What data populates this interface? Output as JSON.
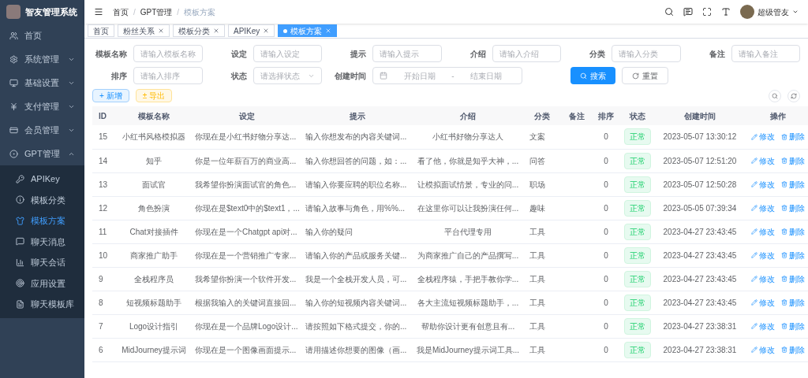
{
  "sidebar": {
    "title": "智友管理系统",
    "items": [
      {
        "label": "首页",
        "selected": false
      },
      {
        "label": "系统管理",
        "expanded": false,
        "selected": false
      },
      {
        "label": "基础设置",
        "expanded": false,
        "selected": false
      },
      {
        "label": "支付管理",
        "expanded": false,
        "selected": false
      },
      {
        "label": "会员管理",
        "expanded": false,
        "selected": false
      },
      {
        "label": "GPT管理",
        "expanded": true,
        "selected": false,
        "children": [
          {
            "label": "APIKey",
            "selected": false
          },
          {
            "label": "模板分类",
            "selected": false
          },
          {
            "label": "模板方案",
            "selected": true
          },
          {
            "label": "聊天消息",
            "selected": false
          },
          {
            "label": "聊天会话",
            "selected": false
          },
          {
            "label": "应用设置",
            "selected": false
          },
          {
            "label": "聊天模板库",
            "selected": false
          }
        ]
      }
    ]
  },
  "header": {
    "breadcrumbs": [
      "首页",
      "GPT管理",
      "模板方案"
    ],
    "separator": "/",
    "user": "超级管友"
  },
  "tags": [
    {
      "label": "首页",
      "closable": false,
      "selected": false
    },
    {
      "label": "粉丝关系",
      "closable": true,
      "selected": false
    },
    {
      "label": "模板分类",
      "closable": true,
      "selected": false
    },
    {
      "label": "APIKey",
      "closable": true,
      "selected": false
    },
    {
      "label": "模板方案",
      "closable": true,
      "selected": true
    }
  ],
  "filters": [
    {
      "kind": "text",
      "label": "模板名称",
      "placeholder": "请输入模板名称"
    },
    {
      "kind": "text",
      "label": "设定",
      "placeholder": "请输入设定"
    },
    {
      "kind": "text",
      "label": "提示",
      "placeholder": "请输入提示"
    },
    {
      "kind": "text",
      "label": "介绍",
      "placeholder": "请输入介绍"
    },
    {
      "kind": "text",
      "label": "分类",
      "placeholder": "请输入分类"
    },
    {
      "kind": "text",
      "label": "备注",
      "placeholder": "请输入备注"
    },
    {
      "kind": "text",
      "label": "排序",
      "placeholder": "请输入排序"
    },
    {
      "kind": "select",
      "label": "状态",
      "placeholder": "请选择状态"
    },
    {
      "kind": "daterange",
      "label": "创建时间",
      "placeholder": "开始日期",
      "placeholder_end": "结束日期",
      "separator": "-"
    }
  ],
  "filter_buttons": [
    {
      "kind": "primary",
      "label": "搜索"
    },
    {
      "kind": "plain",
      "label": "重置"
    }
  ],
  "toolbar": [
    {
      "kind": "add",
      "label": "+ 新增"
    },
    {
      "kind": "export",
      "label": "± 导出"
    }
  ],
  "table": {
    "columns": [
      "ID",
      "模板名称",
      "设定",
      "提示",
      "介绍",
      "分类",
      "备注",
      "排序",
      "状态",
      "创建时间",
      "操作"
    ],
    "rows": [
      {
        "id": "15",
        "name": "小红书风格模拟器",
        "setting": "你现在是小红书好物分享达...",
        "prompt": "输入你想发布的内容关键词...",
        "intro": "小红书好物分享达人",
        "category": "文案",
        "sort": "0",
        "status": "正常",
        "created": "2023-05-07 13:30:12",
        "actions": [
          "修改",
          "删除"
        ]
      },
      {
        "id": "14",
        "name": "知乎",
        "setting": "你是一位年薪百万的商业高...",
        "prompt": "输入你想回答的问题，如：...",
        "intro": "看了他，你就是知乎大神，...",
        "category": "问答",
        "sort": "0",
        "status": "正常",
        "created": "2023-05-07 12:51:20",
        "actions": [
          "修改",
          "删除"
        ]
      },
      {
        "id": "13",
        "name": "面试官",
        "setting": "我希望你扮演面试官的角色...",
        "prompt": "请输入你要应聘的职位名称...",
        "intro": "让模拟面试情景，专业的问...",
        "category": "职场",
        "sort": "0",
        "status": "正常",
        "created": "2023-05-07 12:50:28",
        "actions": [
          "修改",
          "删除"
        ]
      },
      {
        "id": "12",
        "name": "角色扮演",
        "setting": "你现在是$text0中的$text1，...",
        "prompt": "请输入故事与角色，用%%...",
        "intro": "在这里你可以让我扮演任何...",
        "category": "趣味",
        "sort": "0",
        "status": "正常",
        "created": "2023-05-05 07:39:34",
        "actions": [
          "修改",
          "删除"
        ]
      },
      {
        "id": "11",
        "name": "Chat对接插件",
        "setting": "你现在是一个Chatgpt api对...",
        "prompt": "输入你的疑问",
        "intro": "平台代理专用",
        "category": "工具",
        "sort": "0",
        "status": "正常",
        "created": "2023-04-27 23:43:45",
        "actions": [
          "修改",
          "删除"
        ]
      },
      {
        "id": "10",
        "name": "商家推广助手",
        "setting": "你现在是一个营销推广专家...",
        "prompt": "请输入你的产品或服务关键...",
        "intro": "为商家推广自己的产品撰写...",
        "category": "工具",
        "sort": "0",
        "status": "正常",
        "created": "2023-04-27 23:43:45",
        "actions": [
          "修改",
          "删除"
        ]
      },
      {
        "id": "9",
        "name": "全栈程序员",
        "setting": "我希望你扮演一个软件开发...",
        "prompt": "我是一个全栈开发人员，可...",
        "intro": "全栈程序猿，手把手教你学...",
        "category": "工具",
        "sort": "0",
        "status": "正常",
        "created": "2023-04-27 23:43:45",
        "actions": [
          "修改",
          "删除"
        ]
      },
      {
        "id": "8",
        "name": "短视频标题助手",
        "setting": "根据我输入的关键词直接回...",
        "prompt": "输入你的短视频内容关键词...",
        "intro": "各大主流短视频标题助手，...",
        "category": "工具",
        "sort": "0",
        "status": "正常",
        "created": "2023-04-27 23:43:45",
        "actions": [
          "修改",
          "删除"
        ]
      },
      {
        "id": "7",
        "name": "Logo设计指引",
        "setting": "你现在是一个品牌Logo设计...",
        "prompt": "请按照如下格式提交，你的...",
        "intro": "帮助你设计更有创意且有...",
        "category": "工具",
        "sort": "0",
        "status": "正常",
        "created": "2023-04-27 23:38:31",
        "actions": [
          "修改",
          "删除"
        ]
      },
      {
        "id": "6",
        "name": "MidJourney提示词",
        "setting": "你现在是一个图像画面提示...",
        "prompt": "请用描述你想要的图像（画...",
        "intro": "我是MidJourney提示词工具...",
        "category": "工具",
        "sort": "0",
        "status": "正常",
        "created": "2023-04-27 23:38:31",
        "actions": [
          "修改",
          "删除"
        ]
      }
    ]
  }
}
